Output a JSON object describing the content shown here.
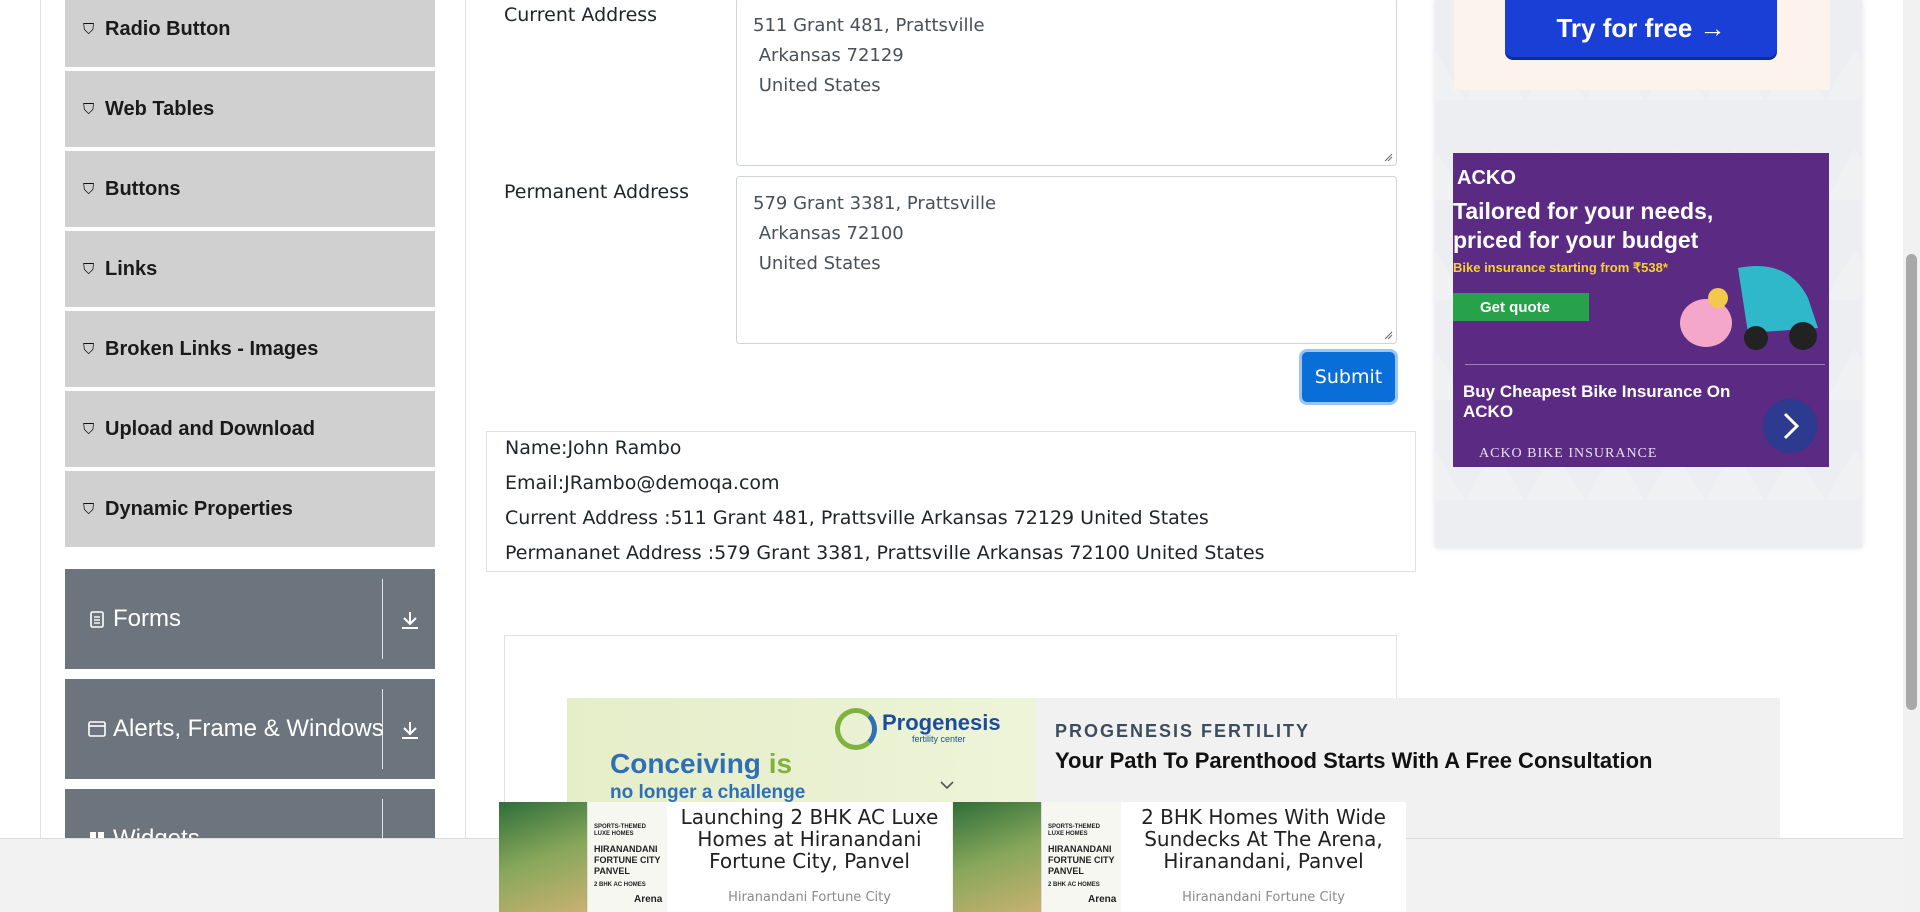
{
  "sidebar": {
    "elements_items": [
      {
        "label": "Radio Button",
        "icon": "html5-icon"
      },
      {
        "label": "Web Tables",
        "icon": "html5-icon"
      },
      {
        "label": "Buttons",
        "icon": "html5-icon"
      },
      {
        "label": "Links",
        "icon": "html5-icon"
      },
      {
        "label": "Broken Links - Images",
        "icon": "html5-icon"
      },
      {
        "label": "Upload and Download",
        "icon": "html5-icon"
      },
      {
        "label": "Dynamic Properties",
        "icon": "html5-icon"
      }
    ],
    "groups": [
      {
        "label": "Forms",
        "icon": "document-icon"
      },
      {
        "label": "Alerts, Frame & Windows",
        "icon": "window-icon"
      },
      {
        "label": "Widgets",
        "icon": "widgets-icon"
      }
    ]
  },
  "form": {
    "current_address_label": "Current Address",
    "current_address_lines": [
      "511 Grant 481, Prattsville",
      " Arkansas 72129",
      " United States"
    ],
    "permanent_address_label": "Permanent Address",
    "permanent_address_lines": [
      "579 Grant 3381, Prattsville",
      " Arkansas 72100",
      " United States"
    ],
    "submit_label": "Submit"
  },
  "output": {
    "name": "Name:John Rambo",
    "email": "Email:JRambo@demoqa.com",
    "current_address": "Current Address :511 Grant 481, Prattsville Arkansas 72129 United States",
    "permanent_address": "Permananet Address :579 Grant 3381, Prattsville Arkansas 72100 United States"
  },
  "ads": {
    "try_free_label": "Try for free →",
    "acko": {
      "logo": "ACKO",
      "headline": "Tailored for your needs, priced for your budget",
      "offer": "Bike insurance starting from ₹538*",
      "cta": "Get quote",
      "caption_title": "Buy Cheapest Bike Insurance On ACKO",
      "caption_sub": "ACKO BIKE INSURANCE"
    },
    "progenesis": {
      "brand": "Progenesis",
      "brand_sub": "fertility center",
      "image_headline_1": "Conceiving",
      "image_headline_2": "is",
      "image_subline": "no longer a challenge",
      "advertiser": "PROGENESIS FERTILITY",
      "title": "Your Path To Parenthood Starts With A Free Consultation"
    },
    "bottom_tiles": [
      {
        "title": "Launching 2 BHK AC Luxe Homes at Hiranandani Fortune City, Panvel",
        "source": "Hiranandani Fortune City",
        "board_lines": [
          "SPORTS-THEMED",
          "LUXE HOMES",
          "HIRANANDANI",
          "FORTUNE CITY",
          "PANVEL",
          "2 BHK AC HOMES",
          "Arena"
        ]
      },
      {
        "title": "2 BHK Homes With Wide Sundecks At The Arena, Hiranandani, Panvel",
        "source": "Hiranandani Fortune City",
        "board_lines": [
          "SPORTS-THEMED",
          "LUXE HOMES",
          "HIRANANDANI",
          "FORTUNE CITY",
          "PANVEL",
          "2 BHK AC HOMES",
          "Arena"
        ]
      }
    ]
  },
  "colors": {
    "sidebar_item_bg": "#d0d0d0",
    "group_bg": "#6c757d",
    "submit_bg": "#0a6ed8",
    "try_button_bg": "#1a3fd6",
    "acko_bg": "#5b2a83"
  }
}
